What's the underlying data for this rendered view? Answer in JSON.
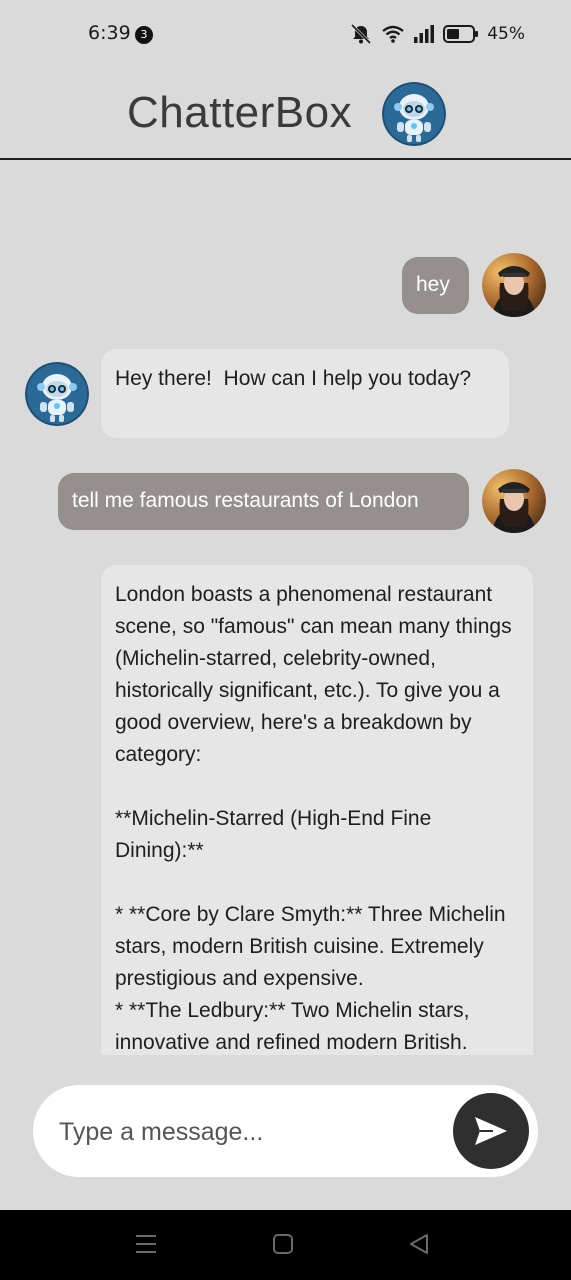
{
  "status_bar": {
    "time": "6:39",
    "notification_count": "3",
    "battery": "45%",
    "icons": [
      "mute-icon",
      "wifi-icon",
      "signal-icon",
      "battery-icon"
    ]
  },
  "header": {
    "title": "ChatterBox",
    "avatar_icon": "robot-avatar-icon"
  },
  "messages": [
    {
      "sender": "user",
      "text": "hey"
    },
    {
      "sender": "bot",
      "text": "Hey there!  How can I help you today?"
    },
    {
      "sender": "user",
      "text": "tell me famous restaurants of London"
    },
    {
      "sender": "bot",
      "text": "London boasts a phenomenal restaurant scene, so \"famous\" can mean many things (Michelin-starred, celebrity-owned, historically significant, etc.). To give you a good overview, here's a breakdown by category:\n\n**Michelin-Starred (High-End Fine Dining):**\n\n* **Core by Clare Smyth:** Three Michelin stars, modern British cuisine. Extremely prestigious and expensive.\n* **The Ledbury:** Two Michelin stars, innovative and refined modern British."
    }
  ],
  "composer": {
    "placeholder": "Type a message...",
    "send_icon": "send-icon"
  },
  "nav_bar": [
    "menu-icon",
    "home-icon",
    "back-icon"
  ],
  "colors": {
    "background": "#dadada",
    "user_bubble": "#958f8e",
    "bot_bubble": "#e6e6e6",
    "send_button": "#2f2f2f"
  }
}
